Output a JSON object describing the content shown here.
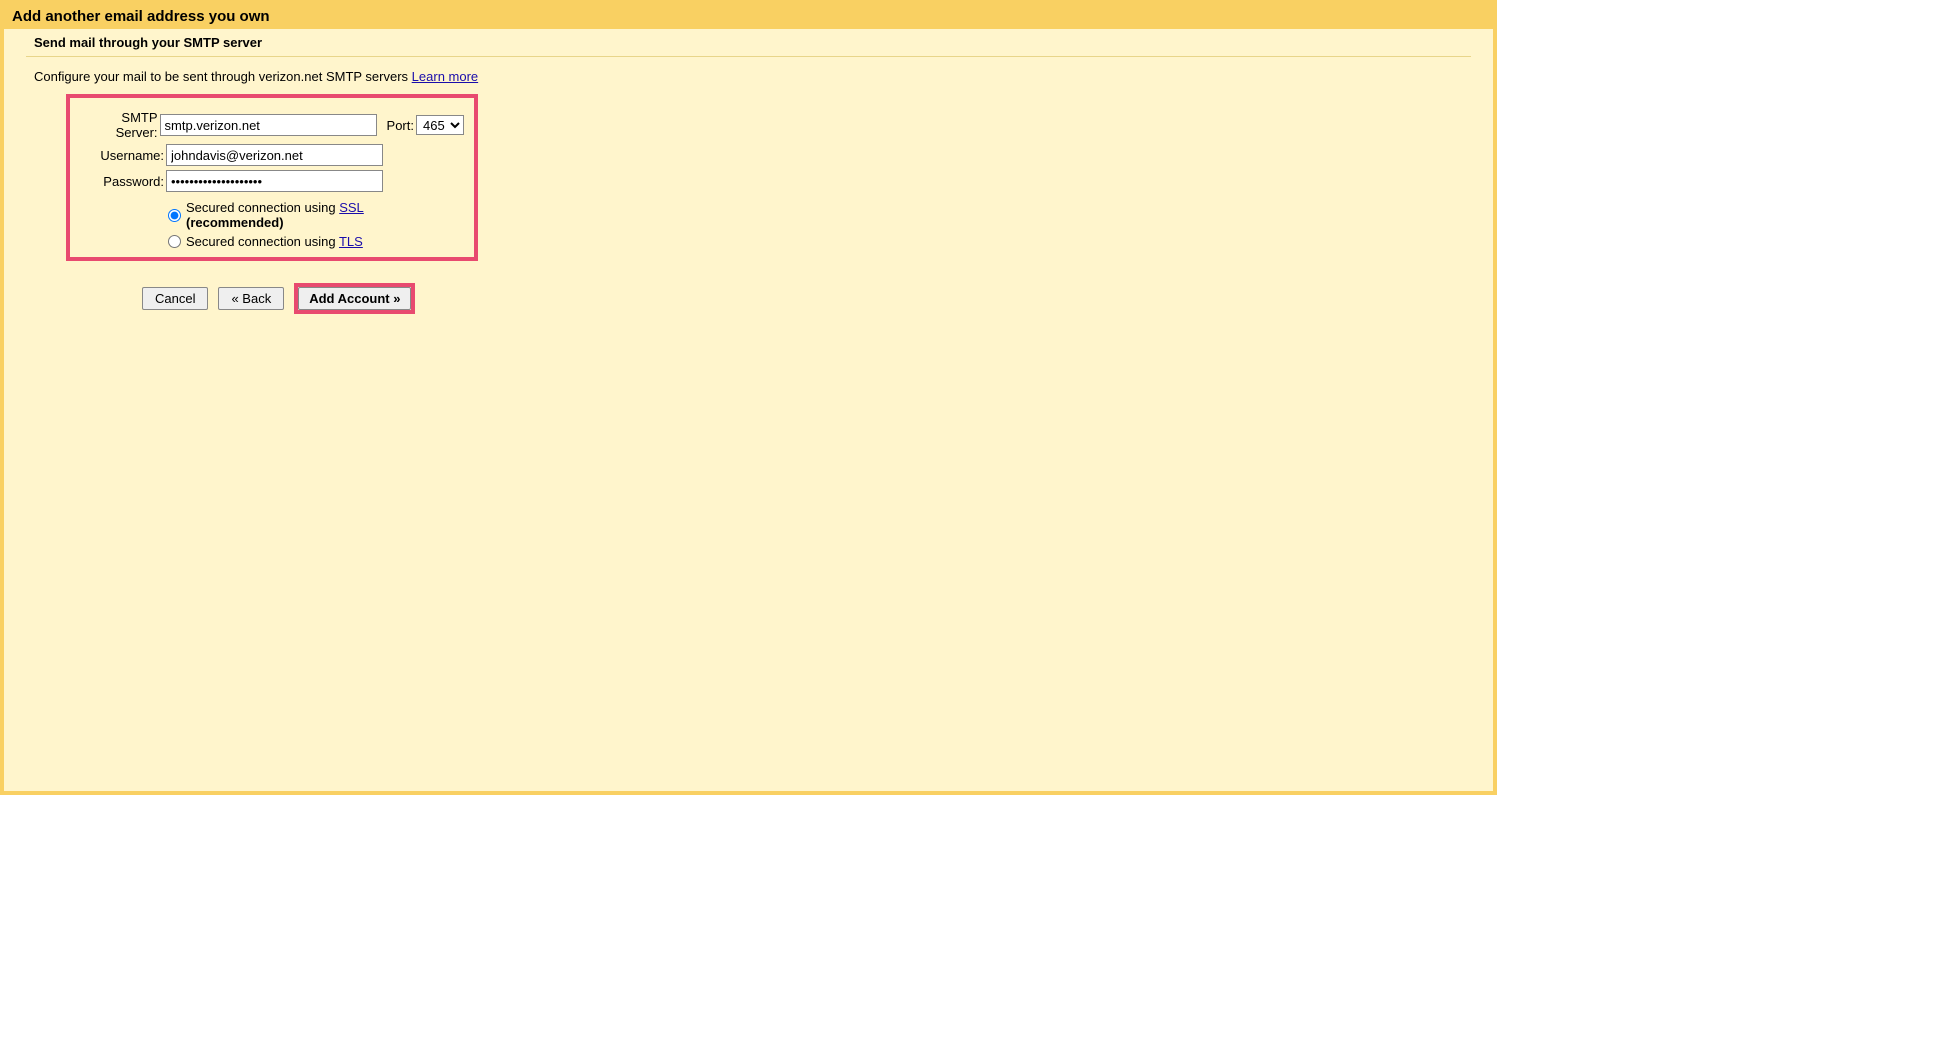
{
  "window": {
    "title": "Add another email address you own",
    "subtitle": "Send mail through your SMTP server",
    "config_prefix": "Configure your mail to be sent through verizon.net SMTP servers ",
    "learn_more": "Learn more"
  },
  "form": {
    "smtp_label": "SMTP Server:",
    "smtp_value": "smtp.verizon.net",
    "port_label": "Port:",
    "port_value": "465",
    "username_label": "Username:",
    "username_value": "johndavis@verizon.net",
    "password_label": "Password:",
    "password_value": "••••••••••••••••••••",
    "ssl_prefix": "Secured connection using ",
    "ssl_link": "SSL",
    "ssl_recommended": " (recommended)",
    "tls_prefix": "Secured connection using ",
    "tls_link": "TLS"
  },
  "buttons": {
    "cancel": "Cancel",
    "back": "« Back",
    "add_account": "Add Account »"
  }
}
